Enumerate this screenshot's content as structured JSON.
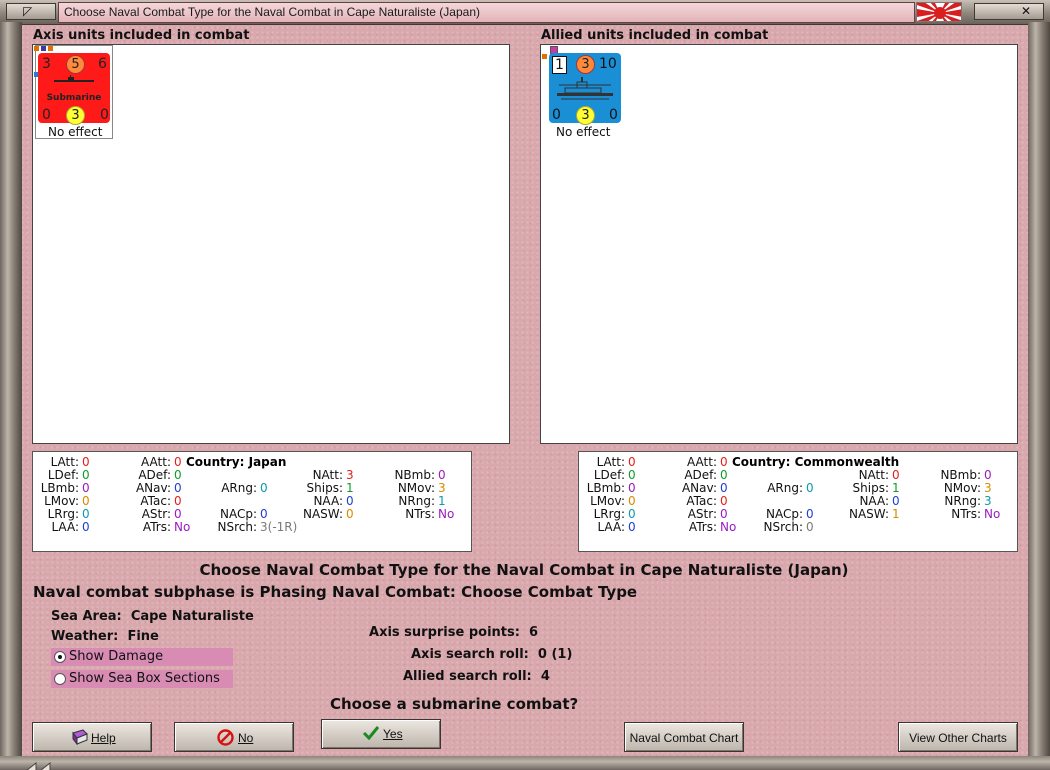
{
  "window": {
    "title": "Choose Naval Combat Type for the Naval Combat in Cape Naturaliste (Japan)"
  },
  "axis": {
    "header": "Axis units included in combat",
    "unit": {
      "tl": "3",
      "tc": "5",
      "tr": "6",
      "name": "Submarine",
      "bl": "0",
      "bc": "3",
      "br": "0",
      "effect": "No effect",
      "color": "#ff1a1a"
    },
    "stats": {
      "country_label": "Country:",
      "country": "Japan",
      "col1": [
        [
          "LAtt:",
          "0"
        ],
        [
          "LDef:",
          "0"
        ],
        [
          "LBmb:",
          "0"
        ],
        [
          "LMov:",
          "0"
        ],
        [
          "LRrg:",
          "0"
        ],
        [
          "LAA:",
          "0"
        ]
      ],
      "col2": [
        [
          "AAtt:",
          "0"
        ],
        [
          "ADef:",
          "0"
        ],
        [
          "ANav:",
          "0"
        ],
        [
          "ATac:",
          "0"
        ],
        [
          "AStr:",
          "0"
        ],
        [
          "ATrs:",
          "No"
        ]
      ],
      "col3": [
        [
          "ARng:",
          "0"
        ],
        [
          "NACp:",
          "0"
        ],
        [
          "NSrch:",
          "3(-1R)"
        ]
      ],
      "col4": [
        [
          "NAtt:",
          "3"
        ],
        [
          "Ships:",
          "1"
        ],
        [
          "NAA:",
          "0"
        ],
        [
          "NASW:",
          "0"
        ]
      ],
      "col5": [
        [
          "NBmb:",
          "0"
        ],
        [
          "NMov:",
          "3"
        ],
        [
          "NRng:",
          "1"
        ],
        [
          "NTrs:",
          "No"
        ]
      ]
    }
  },
  "allied": {
    "header": "Allied units included in combat",
    "unit": {
      "tl": "1",
      "tc": "3",
      "tr": "10",
      "bl": "0",
      "bc": "3",
      "br": "0",
      "effect": "No effect",
      "color": "#1a8fd6"
    },
    "stats": {
      "country_label": "Country:",
      "country": "Commonwealth",
      "col1": [
        [
          "LAtt:",
          "0"
        ],
        [
          "LDef:",
          "0"
        ],
        [
          "LBmb:",
          "0"
        ],
        [
          "LMov:",
          "0"
        ],
        [
          "LRrg:",
          "0"
        ],
        [
          "LAA:",
          "0"
        ]
      ],
      "col2": [
        [
          "AAtt:",
          "0"
        ],
        [
          "ADef:",
          "0"
        ],
        [
          "ANav:",
          "0"
        ],
        [
          "ATac:",
          "0"
        ],
        [
          "AStr:",
          "0"
        ],
        [
          "ATrs:",
          "No"
        ]
      ],
      "col3": [
        [
          "ARng:",
          "0"
        ],
        [
          "NACp:",
          "0"
        ],
        [
          "NSrch:",
          "0"
        ]
      ],
      "col4": [
        [
          "NAtt:",
          "0"
        ],
        [
          "Ships:",
          "1"
        ],
        [
          "NAA:",
          "0"
        ],
        [
          "NASW:",
          "1"
        ]
      ],
      "col5": [
        [
          "NBmb:",
          "0"
        ],
        [
          "NMov:",
          "3"
        ],
        [
          "NRng:",
          "3"
        ],
        [
          "NTrs:",
          "No"
        ]
      ]
    }
  },
  "main": {
    "heading": "Choose Naval Combat Type for the Naval Combat in Cape Naturaliste (Japan)",
    "subphase": "Naval combat subphase is Phasing Naval Combat: Choose Combat Type",
    "sea_area_label": "Sea Area:",
    "sea_area": "Cape Naturaliste",
    "weather_label": "Weather:",
    "weather": "Fine",
    "show_damage": "Show Damage",
    "show_sea_box": "Show Sea Box Sections",
    "axis_surprise_label": "Axis surprise points:",
    "axis_surprise": "6",
    "axis_search_label": "Axis search roll:",
    "axis_search": "0 (1)",
    "allied_search_label": "Allied search roll:",
    "allied_search": "4",
    "question": "Choose a submarine combat?"
  },
  "buttons": {
    "help": "Help",
    "no": "No",
    "yes": "Yes",
    "naval_chart": "Naval Combat Chart",
    "other_charts": "View Other Charts"
  },
  "colors": {
    "red": "#e0211d",
    "green": "#119c2a",
    "blue": "#1e3fcf",
    "teal": "#0f9aa8",
    "purple": "#9a1bbf",
    "orange": "#d98a00",
    "grey": "#7a7a7a"
  }
}
